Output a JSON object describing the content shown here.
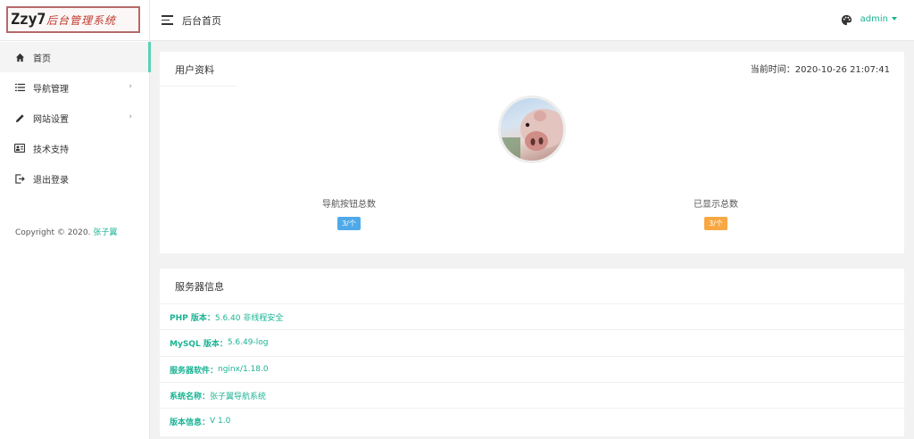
{
  "logo": {
    "main": "Zzy7",
    "sub": "后台管理系统"
  },
  "sidebar": {
    "items": [
      {
        "label": "首页",
        "icon": "home-icon",
        "active": true,
        "arrow": ""
      },
      {
        "label": "导航管理",
        "icon": "list-icon",
        "active": false,
        "arrow": "›"
      },
      {
        "label": "网站设置",
        "icon": "pencil-icon",
        "active": false,
        "arrow": "›"
      },
      {
        "label": "技术支持",
        "icon": "id-card-icon",
        "active": false,
        "arrow": ""
      },
      {
        "label": "退出登录",
        "icon": "logout-icon",
        "active": false,
        "arrow": ""
      }
    ],
    "copyright_prefix": "Copyright © 2020.",
    "copyright_author": "张子翼"
  },
  "header": {
    "title": "后台首页",
    "user": "admin"
  },
  "profile": {
    "title": "用户资料",
    "time_label": "当前时间：2020-10-26 21:07:41",
    "stats": [
      {
        "label": "导航按钮总数",
        "value": "3/个"
      },
      {
        "label": "已显示总数",
        "value": "3/个"
      }
    ]
  },
  "server": {
    "title": "服务器信息",
    "rows": [
      {
        "key": "PHP 版本：",
        "value": "5.6.40 非线程安全"
      },
      {
        "key": "MySQL 版本：",
        "value": "5.6.49-log"
      },
      {
        "key": "服务器软件：",
        "value": "nginx/1.18.0"
      },
      {
        "key": "系统名称：",
        "value": "张子翼导航系统"
      },
      {
        "key": "版本信息：",
        "value": "V 1.0"
      }
    ]
  },
  "colors": {
    "accent": "#1bb394",
    "active_bar": "#5bd1b5",
    "badge_blue": "#4fa9e8",
    "badge_orange": "#f7a843"
  }
}
